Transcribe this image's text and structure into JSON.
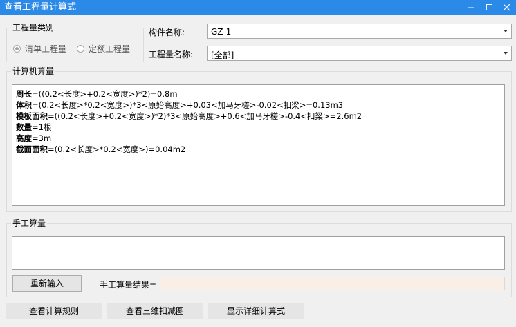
{
  "window": {
    "title": "查看工程量计算式"
  },
  "qty_category": {
    "legend": "工程量类别",
    "options": [
      {
        "label": "清单工程量",
        "checked": true
      },
      {
        "label": "定额工程量",
        "checked": false
      }
    ]
  },
  "fields": {
    "component_label": "构件名称:",
    "component_value": "GZ-1",
    "qty_name_label": "工程量名称:",
    "qty_name_value": "[全部]"
  },
  "computer_calc": {
    "legend": "计算机算量",
    "lines": [
      {
        "name": "周长",
        "expr": "=((0.2<长度>+0.2<宽度>)*2)=0.8m"
      },
      {
        "name": "体积",
        "expr": "=(0.2<长度>*0.2<宽度>)*3<原始高度>+0.03<加马牙槎>-0.02<扣梁>=0.13m3"
      },
      {
        "name": "模板面积",
        "expr": "=((0.2<长度>+0.2<宽度>)*2)*3<原始高度>+0.6<加马牙槎>-0.4<扣梁>=2.6m2"
      },
      {
        "name": "数量",
        "expr": "=1根"
      },
      {
        "name": "高度",
        "expr": "=3m"
      },
      {
        "name": "截面面积",
        "expr": "=(0.2<长度>*0.2<宽度>)=0.04m2"
      }
    ]
  },
  "manual_calc": {
    "legend": "手工算量",
    "reenter_label": "重新输入",
    "result_label": "手工算量结果=",
    "result_value": ""
  },
  "bottom_buttons": {
    "view_rules": "查看计算规则",
    "view_3d": "查看三维扣减图",
    "show_detail": "显示详细计算式"
  }
}
